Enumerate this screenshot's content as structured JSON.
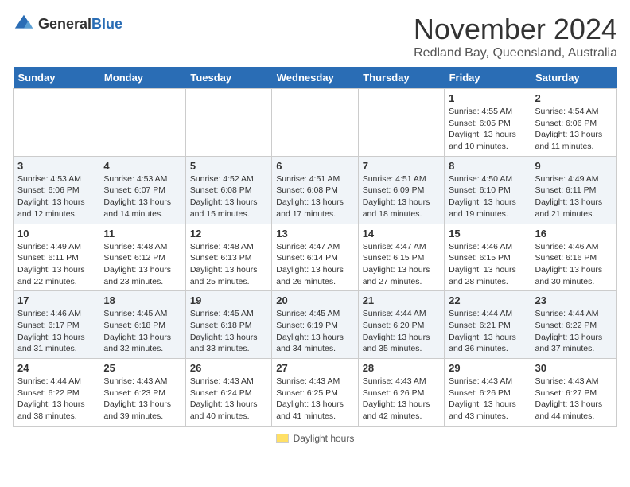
{
  "header": {
    "logo_general": "General",
    "logo_blue": "Blue",
    "month_year": "November 2024",
    "location": "Redland Bay, Queensland, Australia"
  },
  "legend": {
    "box_label": "Daylight hours"
  },
  "weekdays": [
    "Sunday",
    "Monday",
    "Tuesday",
    "Wednesday",
    "Thursday",
    "Friday",
    "Saturday"
  ],
  "weeks": [
    [
      {
        "day": "",
        "info": ""
      },
      {
        "day": "",
        "info": ""
      },
      {
        "day": "",
        "info": ""
      },
      {
        "day": "",
        "info": ""
      },
      {
        "day": "",
        "info": ""
      },
      {
        "day": "1",
        "info": "Sunrise: 4:55 AM\nSunset: 6:05 PM\nDaylight: 13 hours\nand 10 minutes."
      },
      {
        "day": "2",
        "info": "Sunrise: 4:54 AM\nSunset: 6:06 PM\nDaylight: 13 hours\nand 11 minutes."
      }
    ],
    [
      {
        "day": "3",
        "info": "Sunrise: 4:53 AM\nSunset: 6:06 PM\nDaylight: 13 hours\nand 12 minutes."
      },
      {
        "day": "4",
        "info": "Sunrise: 4:53 AM\nSunset: 6:07 PM\nDaylight: 13 hours\nand 14 minutes."
      },
      {
        "day": "5",
        "info": "Sunrise: 4:52 AM\nSunset: 6:08 PM\nDaylight: 13 hours\nand 15 minutes."
      },
      {
        "day": "6",
        "info": "Sunrise: 4:51 AM\nSunset: 6:08 PM\nDaylight: 13 hours\nand 17 minutes."
      },
      {
        "day": "7",
        "info": "Sunrise: 4:51 AM\nSunset: 6:09 PM\nDaylight: 13 hours\nand 18 minutes."
      },
      {
        "day": "8",
        "info": "Sunrise: 4:50 AM\nSunset: 6:10 PM\nDaylight: 13 hours\nand 19 minutes."
      },
      {
        "day": "9",
        "info": "Sunrise: 4:49 AM\nSunset: 6:11 PM\nDaylight: 13 hours\nand 21 minutes."
      }
    ],
    [
      {
        "day": "10",
        "info": "Sunrise: 4:49 AM\nSunset: 6:11 PM\nDaylight: 13 hours\nand 22 minutes."
      },
      {
        "day": "11",
        "info": "Sunrise: 4:48 AM\nSunset: 6:12 PM\nDaylight: 13 hours\nand 23 minutes."
      },
      {
        "day": "12",
        "info": "Sunrise: 4:48 AM\nSunset: 6:13 PM\nDaylight: 13 hours\nand 25 minutes."
      },
      {
        "day": "13",
        "info": "Sunrise: 4:47 AM\nSunset: 6:14 PM\nDaylight: 13 hours\nand 26 minutes."
      },
      {
        "day": "14",
        "info": "Sunrise: 4:47 AM\nSunset: 6:15 PM\nDaylight: 13 hours\nand 27 minutes."
      },
      {
        "day": "15",
        "info": "Sunrise: 4:46 AM\nSunset: 6:15 PM\nDaylight: 13 hours\nand 28 minutes."
      },
      {
        "day": "16",
        "info": "Sunrise: 4:46 AM\nSunset: 6:16 PM\nDaylight: 13 hours\nand 30 minutes."
      }
    ],
    [
      {
        "day": "17",
        "info": "Sunrise: 4:46 AM\nSunset: 6:17 PM\nDaylight: 13 hours\nand 31 minutes."
      },
      {
        "day": "18",
        "info": "Sunrise: 4:45 AM\nSunset: 6:18 PM\nDaylight: 13 hours\nand 32 minutes."
      },
      {
        "day": "19",
        "info": "Sunrise: 4:45 AM\nSunset: 6:18 PM\nDaylight: 13 hours\nand 33 minutes."
      },
      {
        "day": "20",
        "info": "Sunrise: 4:45 AM\nSunset: 6:19 PM\nDaylight: 13 hours\nand 34 minutes."
      },
      {
        "day": "21",
        "info": "Sunrise: 4:44 AM\nSunset: 6:20 PM\nDaylight: 13 hours\nand 35 minutes."
      },
      {
        "day": "22",
        "info": "Sunrise: 4:44 AM\nSunset: 6:21 PM\nDaylight: 13 hours\nand 36 minutes."
      },
      {
        "day": "23",
        "info": "Sunrise: 4:44 AM\nSunset: 6:22 PM\nDaylight: 13 hours\nand 37 minutes."
      }
    ],
    [
      {
        "day": "24",
        "info": "Sunrise: 4:44 AM\nSunset: 6:22 PM\nDaylight: 13 hours\nand 38 minutes."
      },
      {
        "day": "25",
        "info": "Sunrise: 4:43 AM\nSunset: 6:23 PM\nDaylight: 13 hours\nand 39 minutes."
      },
      {
        "day": "26",
        "info": "Sunrise: 4:43 AM\nSunset: 6:24 PM\nDaylight: 13 hours\nand 40 minutes."
      },
      {
        "day": "27",
        "info": "Sunrise: 4:43 AM\nSunset: 6:25 PM\nDaylight: 13 hours\nand 41 minutes."
      },
      {
        "day": "28",
        "info": "Sunrise: 4:43 AM\nSunset: 6:26 PM\nDaylight: 13 hours\nand 42 minutes."
      },
      {
        "day": "29",
        "info": "Sunrise: 4:43 AM\nSunset: 6:26 PM\nDaylight: 13 hours\nand 43 minutes."
      },
      {
        "day": "30",
        "info": "Sunrise: 4:43 AM\nSunset: 6:27 PM\nDaylight: 13 hours\nand 44 minutes."
      }
    ]
  ]
}
